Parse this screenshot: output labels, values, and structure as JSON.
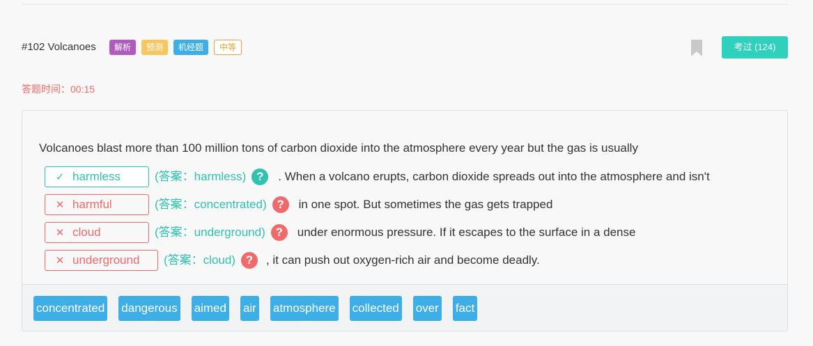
{
  "question": {
    "title": "#102 Volcanoes",
    "tags": [
      "解析",
      "预测",
      "机经题",
      "中等"
    ],
    "done_button": "考过 (124)",
    "timer": "答题时间：00:15"
  },
  "passage": {
    "intro": "Volcanoes blast more than 100 million tons of carbon dioxide into the atmosphere every year but the gas is usually",
    "blanks": [
      {
        "status": "correct",
        "mark": "✓",
        "filled": "harmless",
        "answer": "(答案：harmless)",
        "help": "?",
        "continuation": ". When a volcano erupts, carbon dioxide spreads out into the atmosphere and isn't"
      },
      {
        "status": "wrong",
        "mark": "✕",
        "filled": "harmful",
        "answer": "(答案：concentrated)",
        "help": "?",
        "continuation": "in one spot. But sometimes the gas gets trapped"
      },
      {
        "status": "wrong",
        "mark": "✕",
        "filled": "cloud",
        "answer": "(答案：underground)",
        "help": "?",
        "continuation": "under enormous pressure. If it escapes to the surface in a dense"
      },
      {
        "status": "wrong",
        "mark": "✕",
        "filled": "underground",
        "answer": "(答案：cloud)",
        "help": "?",
        "continuation": ", it can push out oxygen-rich air and become deadly."
      }
    ]
  },
  "word_bank": [
    "concentrated",
    "dangerous",
    "aimed",
    "air",
    "atmosphere",
    "collected",
    "over",
    "fact"
  ],
  "colors": {
    "correct": "#2fc2b0",
    "wrong": "#ef6a6a",
    "word_chip": "#3daee6",
    "done_button": "#2fd0bc"
  },
  "icons": {
    "bookmark": "bookmark-icon",
    "correct": "check-icon",
    "wrong": "cross-icon",
    "help": "question-circle-icon"
  }
}
